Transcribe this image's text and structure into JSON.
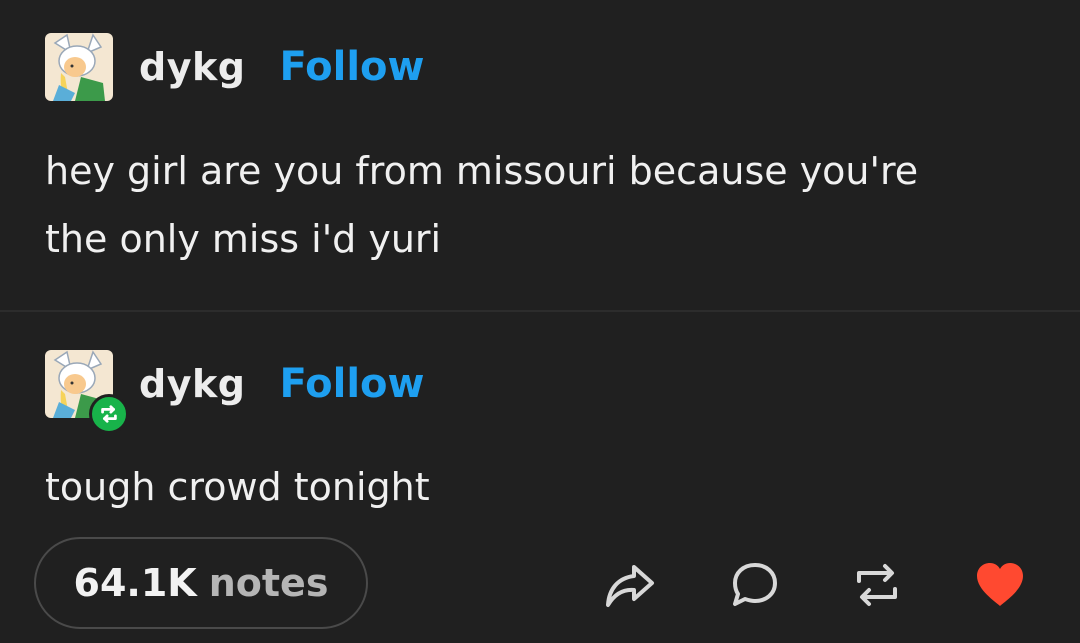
{
  "colors": {
    "background": "#202020",
    "follow": "#1e9ff0",
    "reblog_badge": "#18b34a",
    "like": "#ff4930",
    "text": "#f0f0f0"
  },
  "original_post": {
    "username": "dykg",
    "follow_label": "Follow",
    "text": "hey girl are you from missouri because you're\nthe only miss i'd yuri"
  },
  "reblog_post": {
    "username": "dykg",
    "follow_label": "Follow",
    "text": "tough crowd tonight"
  },
  "footer": {
    "notes_count": "64.1K",
    "notes_label": "notes",
    "icons": [
      "share-icon",
      "comment-icon",
      "reblog-icon",
      "heart-icon"
    ]
  }
}
